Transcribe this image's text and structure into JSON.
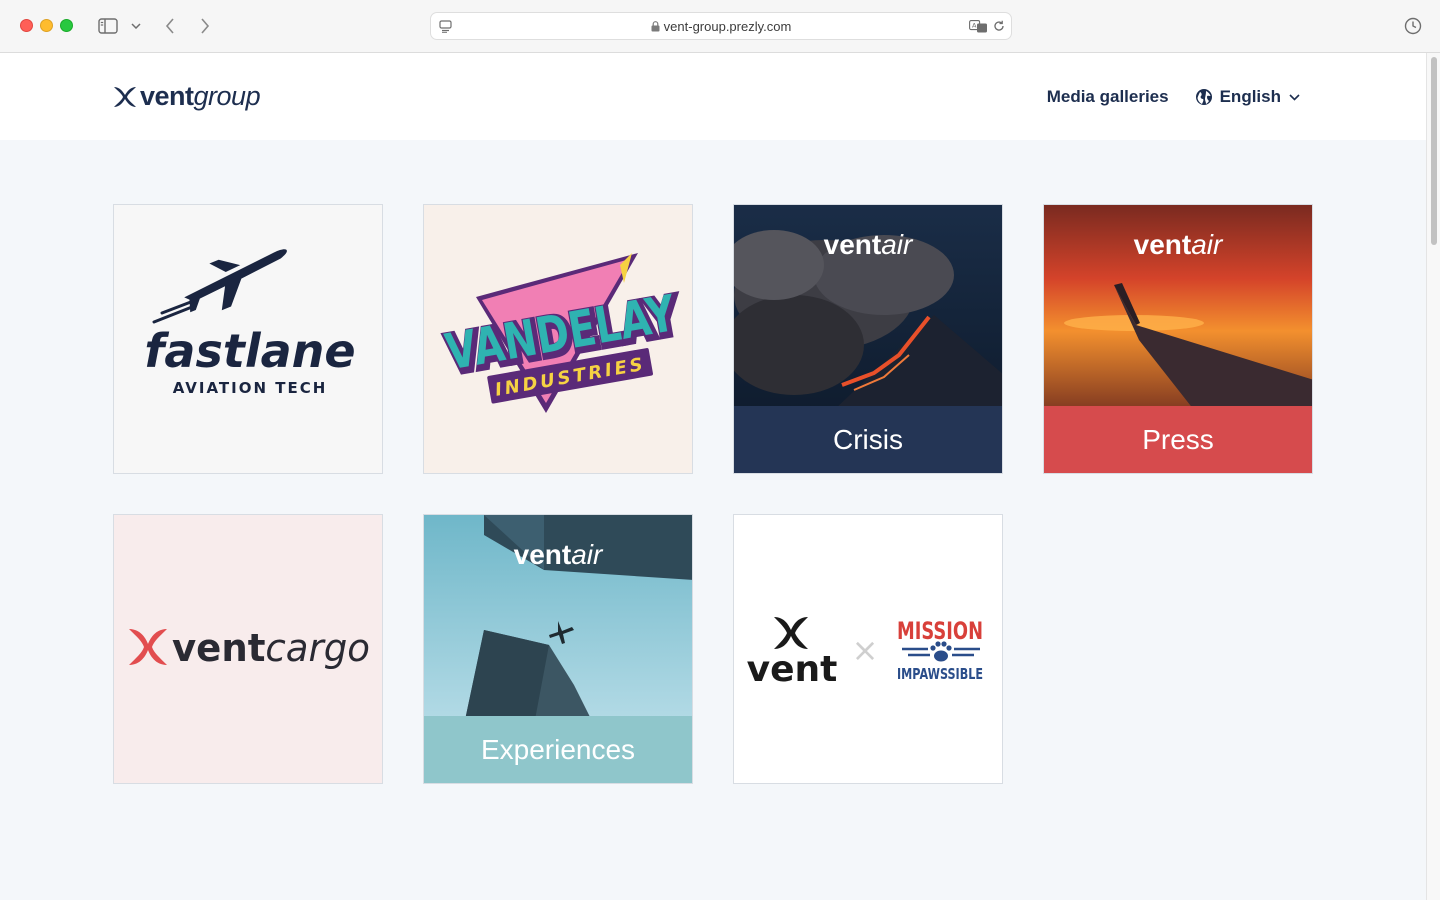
{
  "browser": {
    "url": "vent-group.prezly.com"
  },
  "header": {
    "logo": {
      "bold": "vent",
      "italic": "group"
    },
    "nav_media_galleries": "Media galleries",
    "language": "English"
  },
  "tiles": [
    {
      "id": "fastlane",
      "line1": "fastlane",
      "line2": "AVIATION TECH",
      "bg": "#f7f7f7"
    },
    {
      "id": "vandelay",
      "line1": "VANDELAY",
      "line2": "INDUSTRIES",
      "bg": "#f8f0ea"
    },
    {
      "id": "crisis",
      "brand_bold": "vent",
      "brand_italic": "air",
      "caption": "Crisis",
      "caption_color": "#243555"
    },
    {
      "id": "press",
      "brand_bold": "vent",
      "brand_italic": "air",
      "caption": "Press",
      "caption_color": "#d64b4d"
    },
    {
      "id": "ventcargo",
      "brand_bold": "vent",
      "brand_italic": "cargo",
      "bg": "#f8ecec"
    },
    {
      "id": "experiences",
      "brand_bold": "vent",
      "brand_italic": "air",
      "caption": "Experiences",
      "caption_color": "#8fc6cb"
    },
    {
      "id": "mission",
      "left_word": "vent",
      "separator": "×",
      "right_top": "MISSION",
      "right_bottom": "IMPAWSSIBLE",
      "bg": "#ffffff"
    }
  ],
  "colors": {
    "brand_navy": "#1d2e4f",
    "brand_red": "#e24d4f",
    "page_bg": "#f4f7fa"
  }
}
